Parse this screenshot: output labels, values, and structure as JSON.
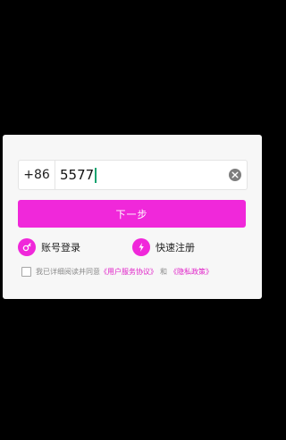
{
  "colors": {
    "accent": "#f028da",
    "link": "#e020c8",
    "backdrop": "#000000",
    "dialog": "#f7f7f7"
  },
  "login": {
    "country_code": "+86",
    "phone_value": "5577",
    "clear_icon": "clear-circle-icon",
    "next_label": "下一步",
    "account_login": {
      "icon": "key-icon",
      "label": "账号登录"
    },
    "quick_register": {
      "icon": "bolt-icon",
      "label": "快速注册"
    },
    "agreement": {
      "prefix": "我已详细阅读并同意",
      "user_agreement": "《用户服务协议》",
      "and": "和",
      "privacy_policy": "《隐私政策》"
    }
  }
}
